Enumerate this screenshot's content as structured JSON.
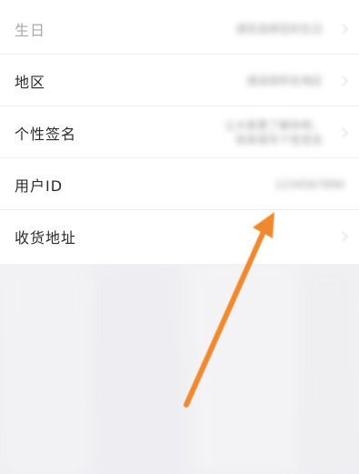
{
  "profile_rows": [
    {
      "label": "生日",
      "value": "请您选择您的生日",
      "has_chevron": true
    },
    {
      "label": "地区",
      "value": "请选择所在地区",
      "has_chevron": true
    },
    {
      "label": "个性签名",
      "value": "让大家更了解你吧，\n快来填写个性签名",
      "has_chevron": true
    },
    {
      "label": "用户ID",
      "value": "1234567890",
      "has_chevron": false
    },
    {
      "label": "收货地址",
      "value": "",
      "has_chevron": true
    }
  ],
  "annotation": {
    "arrow_color": "#f0892e",
    "points_to": "用户ID"
  }
}
